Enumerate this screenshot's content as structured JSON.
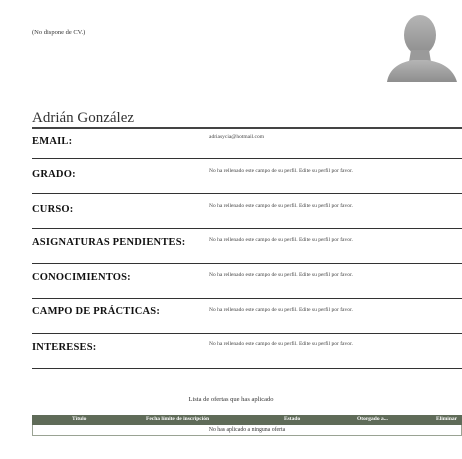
{
  "profile": {
    "cv_note": "(No dispone de CV.)",
    "name": "Adrián González",
    "avatar_icon": "user-silhouette-icon"
  },
  "fields": [
    {
      "label": "EMAIL:",
      "value": "adriasycia@hotmail.com"
    },
    {
      "label": "GRADO:",
      "value": "No ha rellenado este campo de su perfil. Edite su perfil por favor."
    },
    {
      "label": "CURSO:",
      "value": "No ha rellenado este campo de su perfil. Edite su perfil por favor."
    },
    {
      "label": "ASIGNATURAS PENDIENTES:",
      "value": "No ha rellenado este campo de su perfil. Edite su perfil por favor."
    },
    {
      "label": "CONOCIMIENTOS:",
      "value": "No ha rellenado este campo de su perfil. Edite su perfil por favor."
    },
    {
      "label": "CAMPO DE PRÁCTICAS:",
      "value": "No ha rellenado este campo de su perfil. Edite su perfil por favor."
    },
    {
      "label": "INTERESES:",
      "value": "No ha rellenado este campo de su perfil. Edite su perfil por favor."
    }
  ],
  "offers": {
    "title": "Lista de ofertas que has aplicado",
    "columns": [
      "Título",
      "Fecha límite de inscripción",
      "Estado",
      "Otorgado a...",
      "Eliminar"
    ],
    "empty_message": "No has aplicado a ninguna oferta",
    "header_color": "#5f6b58"
  }
}
